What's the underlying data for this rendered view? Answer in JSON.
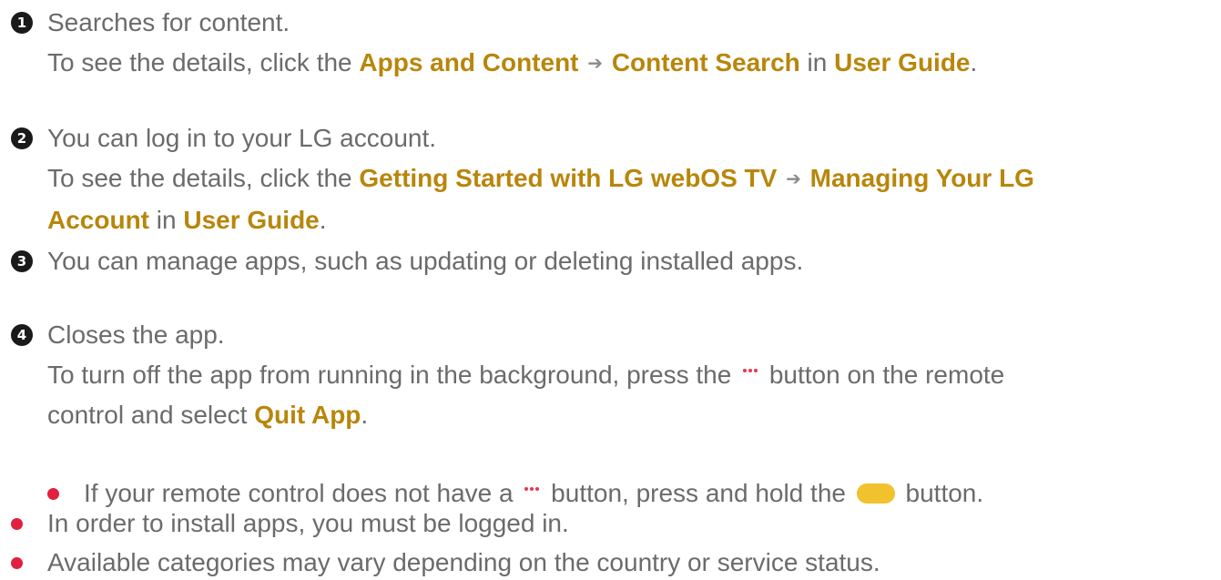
{
  "items": [
    {
      "number": "1",
      "text": "Searches for content.",
      "details": [
        {
          "prefix": "To see the details, click the ",
          "link1": "Apps and Content",
          "arrow": "➔",
          "link2": "Content Search",
          "in": " in ",
          "link3": "User Guide",
          "end": "."
        }
      ]
    },
    {
      "number": "2",
      "text": "You can log in to your LG account.",
      "details": [
        {
          "prefix": "To see the details, click the ",
          "link1": "Getting Started with LG webOS TV",
          "arrow": "➔",
          "link2a": "Managing Your LG",
          "link2b": "Account",
          "in": " in ",
          "link3": "User Guide",
          "end": "."
        }
      ]
    },
    {
      "number": "3",
      "text": "You can manage apps, such as updating or deleting installed apps."
    },
    {
      "number": "4",
      "text": "Closes the app.",
      "detail_line1_before": "To turn off the app from running in the background, press the ",
      "detail_line1_after": " button on the remote",
      "detail_line2_before": "control and select ",
      "detail_link": "Quit App",
      "detail_line2_end": ".",
      "sub_bullet_before": "If your remote control does not have a ",
      "sub_bullet_middle": " button, press and hold the ",
      "sub_bullet_after": " button."
    }
  ],
  "bullets": [
    "In order to install apps, you must be logged in.",
    "Available categories may vary depending on the country or service status."
  ],
  "colors": {
    "link": "#b8860b",
    "body_text": "#6b6b6b",
    "bullet": "#e0203e",
    "dots": "#e8364e",
    "yellow_button": "#f2c12e"
  }
}
